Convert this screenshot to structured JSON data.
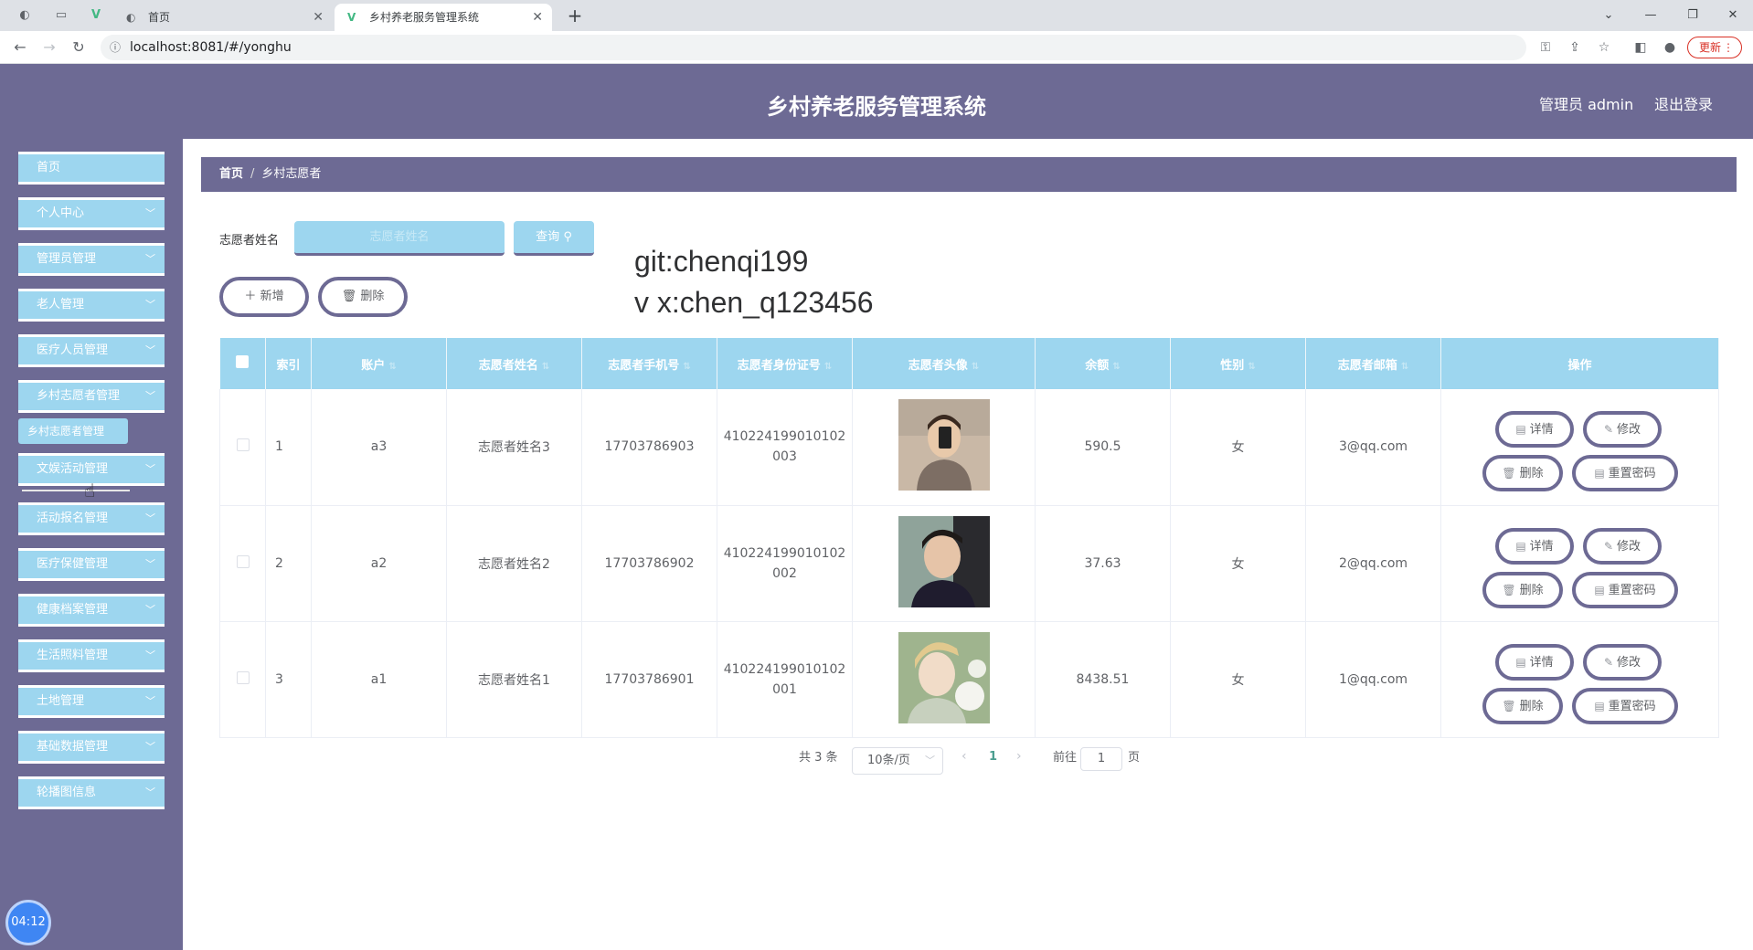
{
  "browser": {
    "tabs": [
      {
        "title": "首页"
      },
      {
        "title": "乡村养老服务管理系统"
      }
    ],
    "url": "localhost:8081/#/yonghu",
    "update_label": "更新"
  },
  "header": {
    "title": "乡村养老服务管理系统",
    "admin_label": "管理员 admin",
    "logout_label": "退出登录"
  },
  "sidebar": {
    "items": [
      {
        "label": "首页"
      },
      {
        "label": "个人中心"
      },
      {
        "label": "管理员管理"
      },
      {
        "label": "老人管理"
      },
      {
        "label": "医疗人员管理"
      },
      {
        "label": "乡村志愿者管理"
      },
      {
        "label": "文娱活动管理"
      },
      {
        "label": "活动报名管理"
      },
      {
        "label": "医疗保健管理"
      },
      {
        "label": "健康档案管理"
      },
      {
        "label": "生活照料管理"
      },
      {
        "label": "土地管理"
      },
      {
        "label": "基础数据管理"
      },
      {
        "label": "轮播图信息"
      }
    ],
    "submenu_label": "乡村志愿者管理"
  },
  "timer": "04:12",
  "breadcrumb": {
    "home": "首页",
    "current": "乡村志愿者"
  },
  "search": {
    "label": "志愿者姓名",
    "placeholder": "志愿者姓名",
    "button": "查询"
  },
  "actions": {
    "add": "新增",
    "delete": "删除"
  },
  "watermark": {
    "line1": "git:chenqi199",
    "line2": "v x:chen_q123456"
  },
  "table": {
    "headers": [
      "索引",
      "账户",
      "志愿者姓名",
      "志愿者手机号",
      "志愿者身份证号",
      "志愿者头像",
      "余额",
      "性别",
      "志愿者邮箱",
      "操作"
    ],
    "rows": [
      {
        "index": "1",
        "account": "a3",
        "name": "志愿者姓名3",
        "phone": "17703786903",
        "id_line1": "410224199010102",
        "id_line2": "003",
        "balance": "590.5",
        "gender": "女",
        "email": "3@qq.com"
      },
      {
        "index": "2",
        "account": "a2",
        "name": "志愿者姓名2",
        "phone": "17703786902",
        "id_line1": "410224199010102",
        "id_line2": "002",
        "balance": "37.63",
        "gender": "女",
        "email": "2@qq.com"
      },
      {
        "index": "3",
        "account": "a1",
        "name": "志愿者姓名1",
        "phone": "17703786901",
        "id_line1": "410224199010102",
        "id_line2": "001",
        "balance": "8438.51",
        "gender": "女",
        "email": "1@qq.com"
      }
    ],
    "row_actions": {
      "detail": "详情",
      "edit": "修改",
      "delete": "删除",
      "reset": "重置密码"
    }
  },
  "pagination": {
    "total": "共 3 条",
    "page_size": "10条/页",
    "current_page": "1",
    "goto_label": "前往",
    "goto_value": "1",
    "page_suffix": "页"
  },
  "colors": {
    "primary": "#6d6a94",
    "accent": "#9dd6ef"
  }
}
